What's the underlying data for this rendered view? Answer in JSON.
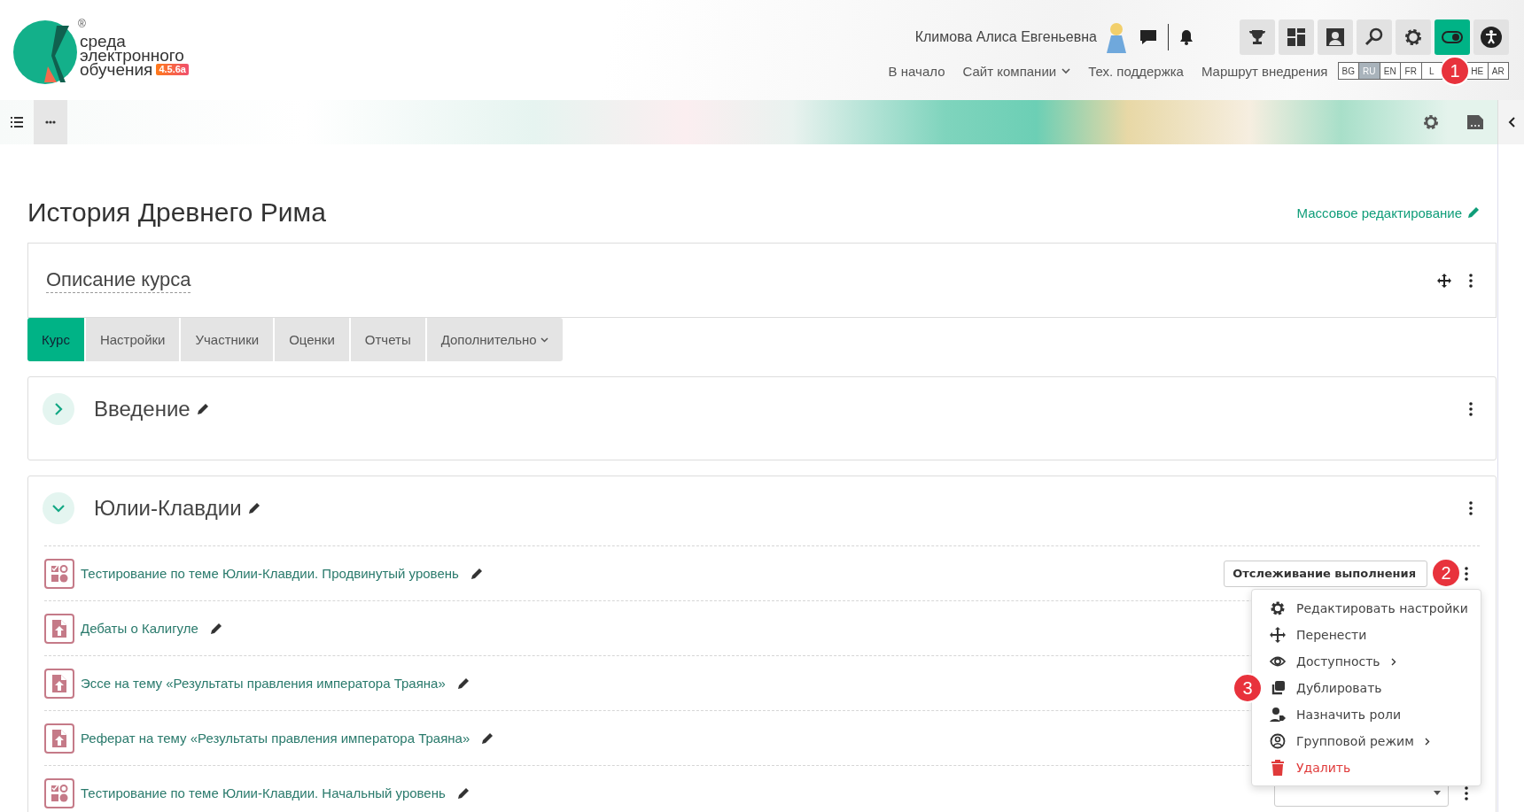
{
  "header": {
    "logo": {
      "lines": [
        "среда",
        "электронного",
        "обучения"
      ],
      "version": "4.5.6a",
      "registered": "®"
    },
    "user_name": "Климова Алиса Евгеньевна",
    "tool_buttons": [
      {
        "kind": "trophy",
        "on": false
      },
      {
        "kind": "dashboard",
        "on": false
      },
      {
        "kind": "profile",
        "on": false
      },
      {
        "kind": "search",
        "on": false
      },
      {
        "kind": "settings",
        "on": false
      },
      {
        "kind": "toggle",
        "on": true
      },
      {
        "kind": "accessibility",
        "on": false
      }
    ],
    "nav": [
      {
        "label": "В начало",
        "has_dropdown": false
      },
      {
        "label": "Сайт компании",
        "has_dropdown": true
      },
      {
        "label": "Тех. поддержка",
        "has_dropdown": false
      },
      {
        "label": "Маршрут внедрения",
        "has_dropdown": false
      }
    ],
    "languages": [
      {
        "kind": "language",
        "code": "BG",
        "selected": false
      },
      {
        "kind": "language",
        "code": "RU",
        "selected": true
      },
      {
        "kind": "language",
        "code": "EN",
        "selected": false
      },
      {
        "kind": "language",
        "code": "FR",
        "selected": false
      },
      {
        "kind": "language",
        "code": "L",
        "selected": false
      },
      {
        "kind": "marker",
        "number": "1"
      },
      {
        "kind": "language",
        "code": "HE",
        "selected": false
      },
      {
        "kind": "language",
        "code": "AR",
        "selected": false
      }
    ]
  },
  "page_title": "История Древнего Рима",
  "bulk_edit_link": "Массовое редактирование",
  "course_description": {
    "title": "Описание курса"
  },
  "tabs": [
    {
      "label": "Курс",
      "selected": true,
      "has_dropdown": false
    },
    {
      "label": "Настройки",
      "selected": false,
      "has_dropdown": false
    },
    {
      "label": "Участники",
      "selected": false,
      "has_dropdown": false
    },
    {
      "label": "Оценки",
      "selected": false,
      "has_dropdown": false
    },
    {
      "label": "Отчеты",
      "selected": false,
      "has_dropdown": false
    },
    {
      "label": "Дополнительно",
      "selected": false,
      "has_dropdown": true
    }
  ],
  "sections": [
    {
      "title": "Введение",
      "expanded": false
    },
    {
      "title": "Юлии-Клавдии",
      "expanded": true,
      "activities": [
        {
          "kind": "quiz",
          "title": "Тестирование по теме Юлии-Клавдии. Продвинутый уровень",
          "completion_button": {
            "label": "Отслеживание выполнения",
            "covered": false
          },
          "kebab": true,
          "marker": "2",
          "menu": [
            {
              "kind": "settings",
              "label": "Редактировать настройки",
              "has_submenu": false,
              "danger": false
            },
            {
              "kind": "move",
              "label": "Перенести",
              "has_submenu": false,
              "danger": false
            },
            {
              "kind": "visibility",
              "label": "Доступность",
              "has_submenu": true,
              "danger": false
            },
            {
              "kind": "duplicate",
              "label": "Дублировать",
              "has_submenu": false,
              "danger": false,
              "marker": "3"
            },
            {
              "kind": "roles",
              "label": "Назначить роли",
              "has_submenu": false,
              "danger": false
            },
            {
              "kind": "group",
              "label": "Групповой режим",
              "has_submenu": true,
              "danger": false
            },
            {
              "kind": "delete",
              "label": "Удалить",
              "has_submenu": false,
              "danger": true
            }
          ]
        },
        {
          "kind": "assignment",
          "title": "Дебаты о Калигуле",
          "kebab": false
        },
        {
          "kind": "assignment",
          "title": "Эссе на тему «Результаты правления императора Траяна»",
          "kebab": false
        },
        {
          "kind": "assignment",
          "title": "Реферат на тему «Результаты правления императора Траяна»",
          "kebab": false
        },
        {
          "kind": "quiz",
          "title": "Тестирование по теме Юлии-Клавдии. Начальный уровень",
          "completion_button": {
            "covered": true
          },
          "kebab": true
        }
      ]
    }
  ]
}
